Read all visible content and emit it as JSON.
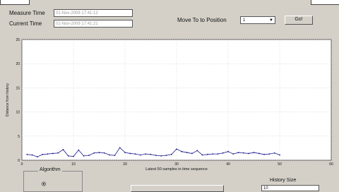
{
  "form": {
    "measure_time_label": "Measure Time",
    "measure_time_value": "01-Nov-2009 17:41:12",
    "current_time_label": "Current Time",
    "current_time_value": "01-Nov-2009 17:41:21",
    "move_label": "Move To to Position",
    "move_value": "1",
    "go_button": "Go!"
  },
  "chart_data": {
    "type": "line",
    "ylabel": "Distance from history",
    "xlabel": "Latest 50 samples in time sequence",
    "ylim": [
      0,
      25
    ],
    "xlim": [
      0,
      60
    ],
    "yticks": [
      0,
      5,
      10,
      15,
      20,
      25
    ],
    "xticks": [
      0,
      10,
      20,
      30,
      40,
      50,
      60
    ],
    "grid": true,
    "color": "#1a1a8c",
    "x": [
      1,
      2,
      3,
      4,
      5,
      6,
      7,
      8,
      9,
      10,
      11,
      12,
      13,
      14,
      15,
      16,
      17,
      18,
      19,
      20,
      21,
      22,
      23,
      24,
      25,
      26,
      27,
      28,
      29,
      30,
      31,
      32,
      33,
      34,
      35,
      36,
      37,
      38,
      39,
      40,
      41,
      42,
      43,
      44,
      45,
      46,
      47,
      48,
      49,
      50
    ],
    "values": [
      1.2,
      1.1,
      0.7,
      1.2,
      1.3,
      1.4,
      1.5,
      2.2,
      0.9,
      0.8,
      2.1,
      0.9,
      1.0,
      1.5,
      1.6,
      1.5,
      1.1,
      1.0,
      2.6,
      1.6,
      1.4,
      1.3,
      1.1,
      1.3,
      1.2,
      1.0,
      0.9,
      1.0,
      1.2,
      2.3,
      1.8,
      1.6,
      1.4,
      2.0,
      1.1,
      1.2,
      1.3,
      1.3,
      1.5,
      1.8,
      1.3,
      1.6,
      1.5,
      1.4,
      1.6,
      1.4,
      1.2,
      1.3,
      1.5,
      1.1
    ]
  },
  "bottom": {
    "algorithm_label": "Algorithm",
    "history_size_label": "History Size",
    "history_size_value": "10"
  }
}
